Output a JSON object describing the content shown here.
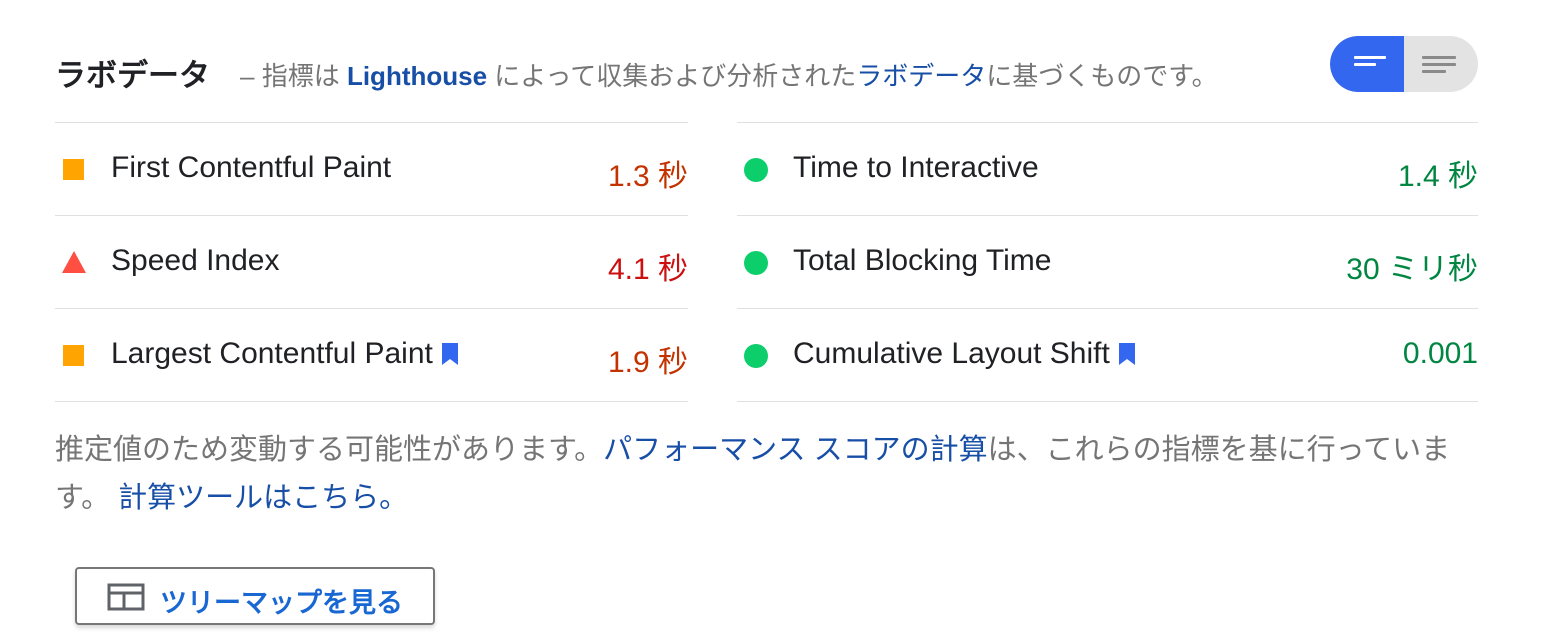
{
  "header": {
    "title": "ラボデータ",
    "dash": "–",
    "desc_prefix": "指標は",
    "lighthouse_link": "Lighthouse",
    "desc_middle": "によって収集および分析された",
    "labdata_link": "ラボデータ",
    "desc_suffix": "に基づくものです。"
  },
  "view_toggle": {
    "left_icon": "summary-view-icon",
    "right_icon": "list-view-icon",
    "active": "left",
    "active_color": "#3367f0"
  },
  "metrics_left": [
    {
      "label": "First Contentful Paint",
      "value": "1.3 秒",
      "status": "average",
      "icon": "square"
    },
    {
      "label": "Speed Index",
      "value": "4.1 秒",
      "status": "fail",
      "icon": "triangle"
    },
    {
      "label": "Largest Contentful Paint",
      "value": "1.9 秒",
      "status": "average",
      "icon": "square",
      "bookmark": true
    }
  ],
  "metrics_right": [
    {
      "label": "Time to Interactive",
      "value": "1.4 秒",
      "status": "pass",
      "icon": "circle"
    },
    {
      "label": "Total Blocking Time",
      "value": "30 ミリ秒",
      "status": "pass",
      "icon": "circle"
    },
    {
      "label": "Cumulative Layout Shift",
      "value": "0.001",
      "status": "pass",
      "icon": "circle",
      "bookmark": true
    }
  ],
  "colors": {
    "pass": "#0cce6b",
    "average": "#ffa400",
    "fail": "#ff4e42",
    "link": "#174ea6",
    "bookmark": "#3367f0"
  },
  "note": {
    "text1": "推定値のため変動する可能性があります。",
    "perf_score_link": "パフォーマンス スコアの計算",
    "text2": "は、これらの指標を基に行っています。",
    "calculator_link": "計算ツールはこちら。"
  },
  "treemap_button": {
    "label": "ツリーマップを見る",
    "icon": "treemap-icon"
  }
}
